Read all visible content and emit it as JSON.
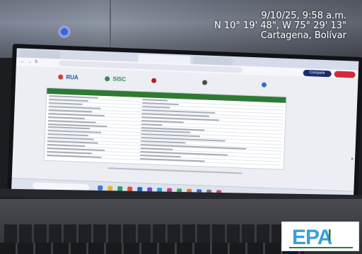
{
  "photo": {
    "geotag": {
      "date_time": "9/10/25, 9:58 a.m.",
      "coordinates": "N 10° 19' 48\", W 75° 29' 13\"",
      "location": "Cartagena, Bolívar"
    }
  },
  "screen": {
    "browser": {
      "tabs": [
        "",
        "",
        ""
      ],
      "url": "",
      "blue_button": "Compartir",
      "red_button": ""
    },
    "page": {
      "logos": [
        "RUA",
        "SISC",
        "",
        "",
        ""
      ],
      "card_title": ""
    },
    "taskbar": {
      "search_placeholder": ""
    }
  },
  "watermark": {
    "brand": "EPA",
    "brand_color": "#3aa0d8",
    "accent_color": "#2f7a33"
  },
  "colors": {
    "screen_header_green": "#2f7a33",
    "blue_button": "#1b2b6e",
    "red_button": "#d62839"
  }
}
